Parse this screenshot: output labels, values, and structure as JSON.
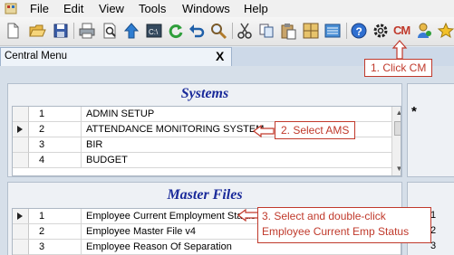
{
  "menubar": {
    "items": [
      "File",
      "Edit",
      "View",
      "Tools",
      "Windows",
      "Help"
    ]
  },
  "toolbar": {
    "icons": [
      "new-document-icon",
      "open-folder-icon",
      "save-icon",
      "print-icon",
      "print-preview-icon",
      "upload-icon",
      "console-icon",
      "refresh-icon",
      "undo-icon",
      "search-icon",
      "cut-icon",
      "copy-icon",
      "paste-icon",
      "grid-icon",
      "list-icon",
      "help-icon",
      "settings-icon",
      "cm-icon",
      "user-icon",
      "star-icon"
    ],
    "cm_label": "CM"
  },
  "document_tab": {
    "title": "Central Menu",
    "close": "X"
  },
  "systems": {
    "header": "Systems",
    "rows": [
      {
        "num": "1",
        "name": "ADMIN SETUP"
      },
      {
        "num": "2",
        "name": "ATTENDANCE MONITORING SYSTEM"
      },
      {
        "num": "3",
        "name": "BIR"
      },
      {
        "num": "4",
        "name": "BUDGET"
      }
    ],
    "new_row_marker": "*"
  },
  "master_files": {
    "header": "Master Files",
    "rows": [
      {
        "num": "1",
        "name": "Employee Current Employment Status"
      },
      {
        "num": "2",
        "name": "Employee Master File v4"
      },
      {
        "num": "3",
        "name": "Employee Reason Of Separation"
      }
    ],
    "side_numbers": [
      "1",
      "2",
      "3"
    ]
  },
  "callouts": {
    "step1": "1. Click CM",
    "step2": "2. Select AMS",
    "step3_line1": "3. Select and double-click",
    "step3_line2": "Employee Current Emp Status"
  },
  "colors": {
    "callout": "#c0392b",
    "header_text": "#1a2a9a"
  }
}
